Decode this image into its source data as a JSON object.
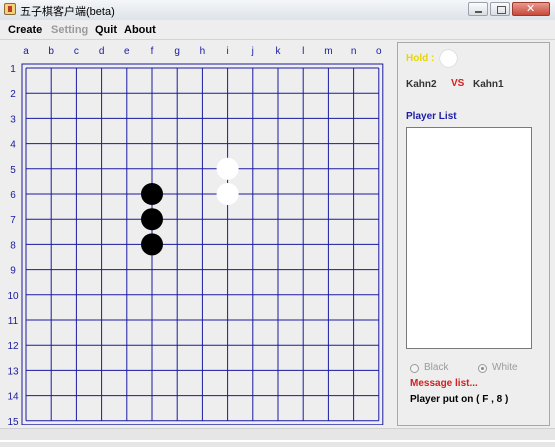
{
  "window": {
    "title": "五子棋客户端(beta)"
  },
  "menu": [
    {
      "label": "Create",
      "enabled": true
    },
    {
      "label": "Setting",
      "enabled": false
    },
    {
      "label": "Quit",
      "enabled": true
    },
    {
      "label": "About",
      "enabled": true
    }
  ],
  "board": {
    "columns": [
      "a",
      "b",
      "c",
      "d",
      "e",
      "f",
      "g",
      "h",
      "i",
      "j",
      "k",
      "l",
      "m",
      "n",
      "o"
    ],
    "rows": [
      "1",
      "2",
      "3",
      "4",
      "5",
      "6",
      "7",
      "8",
      "9",
      "10",
      "11",
      "12",
      "13",
      "14",
      "15"
    ],
    "line_color": "#1a1aa0",
    "stones": [
      {
        "col": "f",
        "row": 6,
        "color": "black"
      },
      {
        "col": "f",
        "row": 7,
        "color": "black"
      },
      {
        "col": "f",
        "row": 8,
        "color": "black"
      },
      {
        "col": "i",
        "row": 5,
        "color": "white"
      },
      {
        "col": "i",
        "row": 6,
        "color": "white"
      }
    ]
  },
  "side": {
    "hold_label": "Hold :",
    "hold_color": "white",
    "player2": "Kahn2",
    "vs": "VS",
    "player1": "Kahn1",
    "player_list_label": "Player List",
    "black_label": "Black",
    "white_label": "White",
    "selected": "White",
    "message_label": "Message list...",
    "message": "Player put on ( F , 8 )"
  }
}
